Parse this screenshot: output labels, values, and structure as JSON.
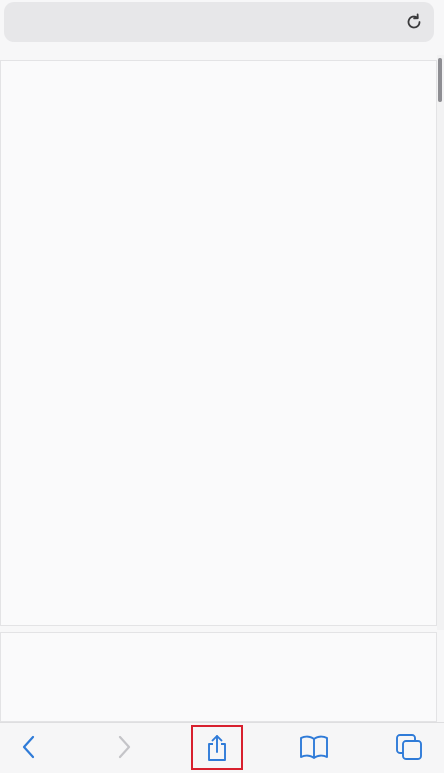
{
  "browser": {
    "address_bar": {
      "url_text": "",
      "reload_icon": "reload-icon"
    },
    "scroll": {
      "position_fraction": 0.0
    }
  },
  "toolbar": {
    "items": [
      {
        "name": "back",
        "icon": "chevron-left-icon",
        "enabled": true
      },
      {
        "name": "forward",
        "icon": "chevron-right-icon",
        "enabled": false
      },
      {
        "name": "share",
        "icon": "share-icon",
        "enabled": true,
        "highlighted": true
      },
      {
        "name": "bookmarks",
        "icon": "book-icon",
        "enabled": true
      },
      {
        "name": "tabs",
        "icon": "tabs-icon",
        "enabled": true
      }
    ]
  },
  "colors": {
    "accent": "#2f7bd8",
    "disabled": "#c4c4c8",
    "highlight": "#d8202e",
    "background": "#f7f7f8"
  }
}
